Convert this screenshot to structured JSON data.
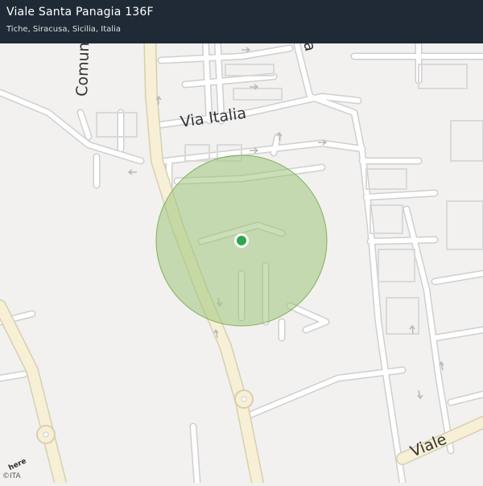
{
  "header": {
    "title": "Viale Santa Panagia 136F",
    "subtitle": "Tiche, Siracusa, Sicilia, Italia"
  },
  "map": {
    "street_labels": {
      "comuni": "Comuni",
      "irlanda": "Irlanda",
      "via_italia": "Via  Italia",
      "viale": "Viale"
    },
    "accuracy_circle_color": "#9fc47a",
    "location_dot_color": "#2ea84a",
    "major_road_color": "#f7f0d7",
    "land_color": "#f2f1f0"
  },
  "attribution": {
    "logo_text": "here",
    "copyright": "©ITA"
  }
}
